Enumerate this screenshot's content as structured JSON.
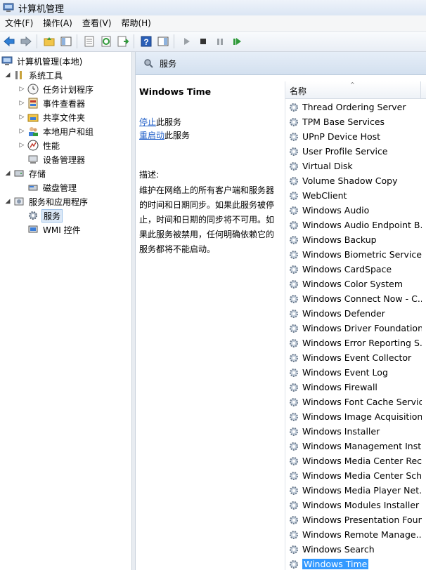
{
  "window": {
    "title": "计算机管理"
  },
  "menu": [
    {
      "label": "文件(F)"
    },
    {
      "label": "操作(A)"
    },
    {
      "label": "查看(V)"
    },
    {
      "label": "帮助(H)"
    }
  ],
  "toolbar": {
    "buttons": [
      "back-icon",
      "forward-icon",
      "up-folder-icon",
      "show-hide-tree-icon",
      "properties-icon",
      "refresh-icon",
      "export-icon",
      "help-icon",
      "show-hide-action-icon",
      "play-icon",
      "stop-icon",
      "pause-icon",
      "restart-icon"
    ]
  },
  "tree": {
    "root": "计算机管理(本地)",
    "system_tools": "系统工具",
    "task_scheduler": "任务计划程序",
    "event_viewer": "事件查看器",
    "shared_folders": "共享文件夹",
    "local_users": "本地用户和组",
    "performance": "性能",
    "device_manager": "设备管理器",
    "storage": "存储",
    "disk_management": "磁盘管理",
    "services_apps": "服务和应用程序",
    "services": "服务",
    "wmi": "WMI 控件"
  },
  "right_header": {
    "label": "服务"
  },
  "description": {
    "service_name": "Windows Time",
    "stop_link": "停止",
    "stop_suffix": "此服务",
    "restart_link": "重启动",
    "restart_suffix": "此服务",
    "heading": "描述:",
    "body": "维护在网络上的所有客户端和服务器的时间和日期同步。如果此服务被停止，时间和日期的同步将不可用。如果此服务被禁用，任何明确依赖它的服务都将不能启动。"
  },
  "services_list": {
    "column_name": "名称",
    "sort_indicator": "^",
    "rows": [
      "Thread Ordering Server",
      "TPM Base Services",
      "UPnP Device Host",
      "User Profile Service",
      "Virtual Disk",
      "Volume Shadow Copy",
      "WebClient",
      "Windows Audio",
      "Windows Audio Endpoint B...",
      "Windows Backup",
      "Windows Biometric Service",
      "Windows CardSpace",
      "Windows Color System",
      "Windows Connect Now - C...",
      "Windows Defender",
      "Windows Driver Foundation...",
      "Windows Error Reporting S...",
      "Windows Event Collector",
      "Windows Event Log",
      "Windows Firewall",
      "Windows Font Cache Service",
      "Windows Image Acquisition...",
      "Windows Installer",
      "Windows Management Inst...",
      "Windows Media Center Rec...",
      "Windows Media Center Sch...",
      "Windows Media Player Net...",
      "Windows Modules Installer",
      "Windows Presentation Foun...",
      "Windows Remote Manage...",
      "Windows Search",
      "Windows Time"
    ],
    "selected": "Windows Time"
  },
  "colors": {
    "accent": "#3399ff",
    "link": "#1f5ec8",
    "header_bg": "#d3e0ef"
  }
}
